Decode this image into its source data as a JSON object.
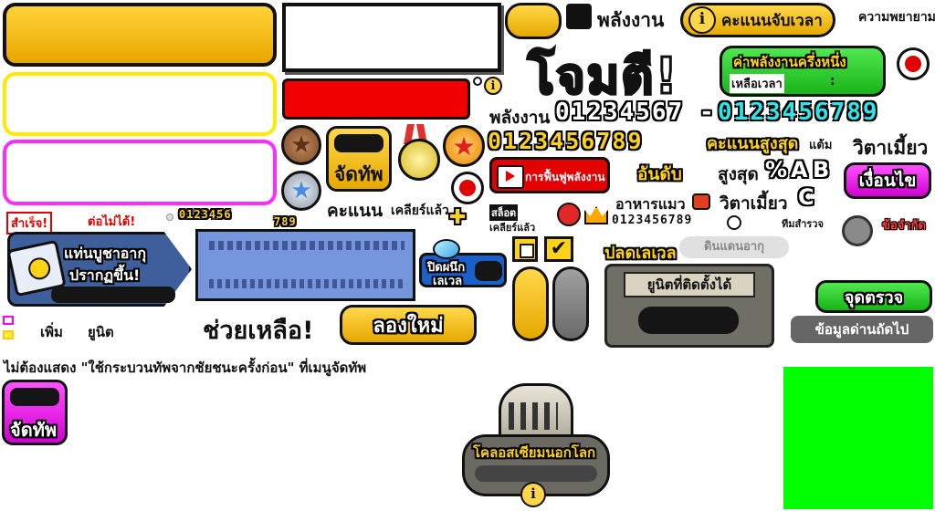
{
  "colors": {
    "gold": "#f2b700",
    "yellow_outline": "#ffff00",
    "magenta": "#ff00ff",
    "red": "#ee0000",
    "green_button": "#22cc22",
    "green_block": "#00ff00",
    "blue_panel": "#6f8fd8",
    "cyan_digits": "#2de4e8",
    "gray_panel": "#6f6f66"
  },
  "icons": {
    "info": "info-icon",
    "record": "record-icon",
    "star": "star-icon",
    "medal": "medal-icon",
    "crown": "crown-icon",
    "clock": "clock-icon",
    "play": "play-icon",
    "plus": "plus-icon",
    "checkbox": "checkbox-icon",
    "colosseum": "colosseum-icon",
    "crystal": "crystal-icon",
    "book": "book-icon"
  },
  "header": {
    "energy_label": "พลังงาน",
    "score_time_label": "คะแนนจับเวลา",
    "effort_label": "ความพยายาม",
    "attack_title": "โจมตี!",
    "half_energy_label": "ค่าพลังงานครึ่งหนึ่ง",
    "time_left_label": "เหลือเวลา",
    "time_left_sep": ":"
  },
  "energy_row": {
    "label": "พลังงาน",
    "white_digits": "01234567",
    "dash": "-",
    "cyan_digits": "0123456789"
  },
  "yellow_digits": {
    "digits": "0123456789",
    "high_score_label": "คะแนนสูงสุด",
    "points_suffix": "แต้ม"
  },
  "misc": {
    "ranking_label": "อันดับ",
    "max_label": "สูงสุด",
    "percent": "%",
    "grade_a": "A",
    "grade_b": "B",
    "grade_c": "C",
    "catfood_label": "อาหารแมว",
    "xp_label": "วิตาเมี้ยว",
    "xp_label2": "วิตาเมี้ยว",
    "conditions_label": "เงื่อนไข",
    "restrictions_label": "ข้อจำกัด",
    "team_total_label": "ทีมสำรวจ",
    "stolen_label": "สล็อต",
    "cleared_small_label": "เคลียร์แล้ว",
    "crown_digits": "0123456789",
    "energy_restore_label": "การฟื้นฟูพลังงาน"
  },
  "row3": {
    "deploy_label": "จัดทัพ",
    "score_label": "คะแนน",
    "cleared_label": "เคลียร์แล้ว",
    "success_label": "สำเร็จ!",
    "failed_label": "ต่อไม่ได้!",
    "small_digits": "0123456",
    "small_digits2": "789"
  },
  "gacha": {
    "title_line1": "แท่นบูชาอากุ",
    "title_line2": "ปรากฏขึ้น!"
  },
  "record_btn": {
    "line1": "ปิดผนึก",
    "line2": "เลเวล"
  },
  "unlock": {
    "unlock_level_label": "ปลดเลเวล",
    "aku_realm_label": "ดินแดนอากุ",
    "equip_title": "ยูนิตที่ติดตั้งได้"
  },
  "buttons": {
    "help_label": "ช่วยเหลือ!",
    "retry_label": "ลองใหม่",
    "checkpoint_label": "จุดตรวจ",
    "next_stage_label": "ข้อมูลด่านถัดไป",
    "deploy_label": "จัดทัพ"
  },
  "legend": {
    "add_label": "เพิ่ม",
    "unit_label": "ยูนิต"
  },
  "notice": {
    "text": "ไม่ต้องแสดง \"ใช้กระบวนทัพจากชัยชนะครั้งก่อน\" ที่เมนูจัดทัพ"
  },
  "colosseum": {
    "label": "โคลอสเซียมนอกโลก"
  }
}
